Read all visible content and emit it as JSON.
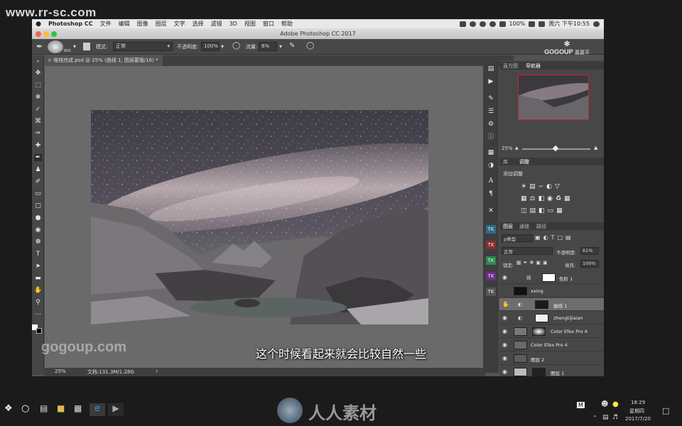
{
  "watermark_site": "www.rr-sc.com",
  "mac_menu": {
    "apple": "",
    "items": [
      "Photoshop CC",
      "文件",
      "编辑",
      "图像",
      "图层",
      "文字",
      "选择",
      "滤镜",
      "3D",
      "视图",
      "窗口",
      "帮助"
    ],
    "battery": "100%",
    "datetime": "周六 下午10:55"
  },
  "window_title": "Adobe Photoshop CC 2017",
  "options": {
    "brush_size": "800",
    "mode_label": "模式:",
    "mode_value": "正常",
    "opacity_label": "不透明度:",
    "opacity_value": "100%",
    "flow_label": "流量:",
    "flow_value": "6%"
  },
  "brand": {
    "logo": "GOGOUP",
    "name": "嘉嘉平"
  },
  "doc_tab": "堆栈完成.psd @ 25% (曲线 1, 图层蒙版/16) *",
  "status": {
    "zoom": "25%",
    "doc": "文档:131.3M/1.28G"
  },
  "nav_panel": {
    "tabs": [
      "直方图",
      "导航器"
    ],
    "zoom": "25%"
  },
  "adjust_panel": {
    "tabs": [
      "库",
      "调整"
    ],
    "title": "添加调整"
  },
  "layers_panel": {
    "tabs": [
      "图层",
      "通道",
      "路径"
    ],
    "filter": "ρ类型",
    "blend": "正常",
    "opacity_label": "不透明度:",
    "opacity_value": "61%",
    "lock_label": "锁定:",
    "fill_label": "填充:",
    "fill_value": "100%",
    "layers": [
      {
        "name": "色阶 1"
      },
      {
        "name": "xxing"
      },
      {
        "name": "曲线 1"
      },
      {
        "name": "zhengtijiaian"
      },
      {
        "name": "Color Efex Pro 4"
      },
      {
        "name": "Color Efex Pro 4"
      },
      {
        "name": "图层 2"
      },
      {
        "name": "图层 1"
      }
    ]
  },
  "watermark_gogoup": "gogoup.com",
  "subtitle": "这个时候看起来就会比较自然一些",
  "bottom_brand": "人人素材",
  "taskbar": {
    "time": "18:29",
    "weekday": "星期四",
    "date": "2017/7/20",
    "ime": "M"
  }
}
